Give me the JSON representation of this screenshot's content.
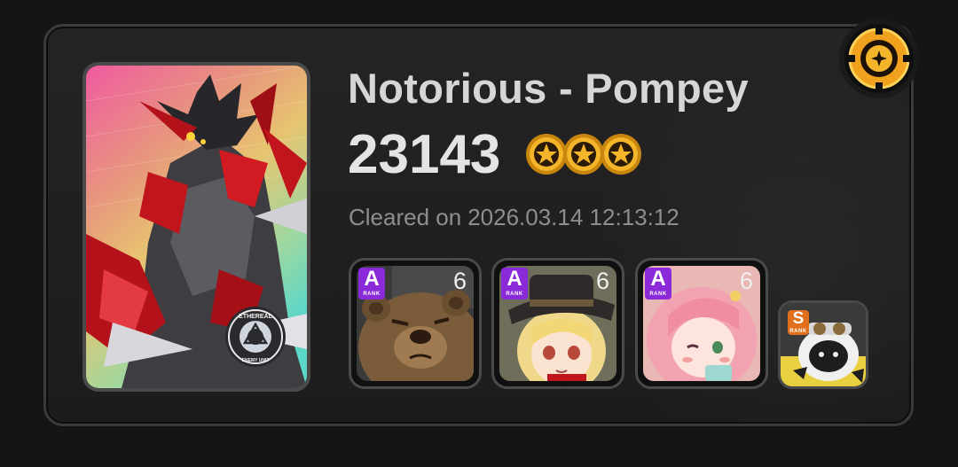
{
  "record": {
    "title": "Notorious - Pompey",
    "score": "23143",
    "cleared_prefix": "Cleared on",
    "cleared_datetime": "2026.03.14 12:13:12",
    "medal_count": 3,
    "medal_icon": "gold-star-medal-icon",
    "corner_icon": "gold-emblem-icon"
  },
  "card": {
    "badge_top": "ETHEREAL",
    "badge_bottom": "ENEMY UNIT",
    "colors": {
      "border": "#4a4a4a",
      "gradient_top": "#f05aa0",
      "gradient_mid": "#e7c470",
      "gradient_bottom": "#5cd6c8"
    }
  },
  "squad": [
    {
      "rank": "A",
      "rank_word": "RANK",
      "level": "6",
      "portrait": "bear-agent"
    },
    {
      "rank": "A",
      "rank_word": "RANK",
      "level": "6",
      "portrait": "blonde-agent-with-hat"
    },
    {
      "rank": "A",
      "rank_word": "RANK",
      "level": "6",
      "portrait": "pink-haired-agent"
    }
  ],
  "bangboo": {
    "rank": "S",
    "rank_word": "RANK",
    "portrait": "goggles-bangboo"
  },
  "colors": {
    "rank_a": "#8a2ad8",
    "rank_s": "#e0701c",
    "gold": "#f4b52a",
    "title": "#d6d6d6",
    "muted": "#8e8e8e"
  }
}
